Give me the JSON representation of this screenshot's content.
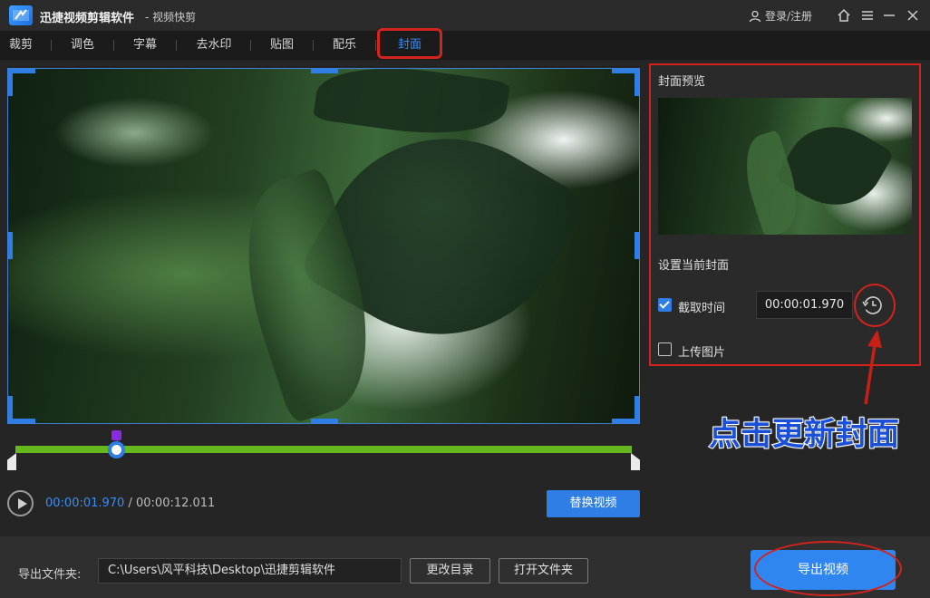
{
  "titlebar": {
    "app_name": "迅捷视频剪辑软件",
    "subtitle": "- 视频快剪",
    "login_label": "登录/注册"
  },
  "tabs": [
    {
      "label": "裁剪"
    },
    {
      "label": "调色"
    },
    {
      "label": "字幕"
    },
    {
      "label": "去水印"
    },
    {
      "label": "贴图"
    },
    {
      "label": "配乐"
    },
    {
      "label": "封面",
      "active": true
    }
  ],
  "player": {
    "current_time": "00:00:01.970",
    "separator": " / ",
    "total_time": "00:00:12.011",
    "replace_label": "替换视频",
    "playhead_fraction": 0.164
  },
  "cover_panel": {
    "preview_title": "封面预览",
    "set_title": "设置当前封面",
    "capture_time_label": "截取时间",
    "capture_time_checked": true,
    "capture_time_value": "00:00:01.970",
    "upload_label": "上传图片",
    "upload_checked": false
  },
  "annotation": {
    "text": "点击更新封面"
  },
  "bottom": {
    "export_folder_label": "导出文件夹:",
    "export_path": "C:\\Users\\风平科技\\Desktop\\迅捷剪辑软件",
    "change_dir_label": "更改目录",
    "open_folder_label": "打开文件夹",
    "export_button_label": "导出视频"
  },
  "colors": {
    "accent": "#2f7ee6",
    "highlight_red": "#d3231c",
    "trim_green": "#66b81f"
  }
}
